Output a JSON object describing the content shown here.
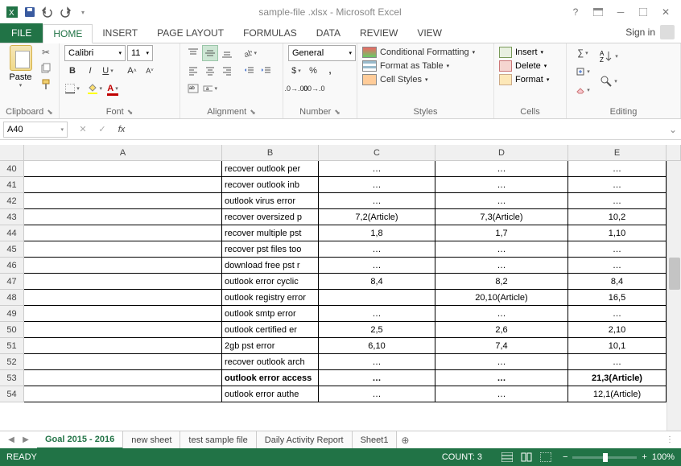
{
  "title": "sample-file .xlsx - Microsoft Excel",
  "signin": "Sign in",
  "tabs": {
    "file": "FILE",
    "list": [
      "HOME",
      "INSERT",
      "PAGE LAYOUT",
      "FORMULAS",
      "DATA",
      "REVIEW",
      "VIEW"
    ],
    "active": 0
  },
  "ribbon": {
    "clipboard": {
      "label": "Clipboard",
      "paste": "Paste"
    },
    "font": {
      "label": "Font",
      "name": "Calibri",
      "size": "11"
    },
    "alignment": {
      "label": "Alignment"
    },
    "number": {
      "label": "Number",
      "format": "General"
    },
    "styles": {
      "label": "Styles",
      "cond": "Conditional Formatting",
      "table": "Format as Table",
      "cell": "Cell Styles"
    },
    "cells": {
      "label": "Cells",
      "insert": "Insert",
      "delete": "Delete",
      "format": "Format"
    },
    "editing": {
      "label": "Editing"
    }
  },
  "namebox": "A40",
  "columns": [
    "A",
    "B",
    "C",
    "D",
    "E"
  ],
  "rows": [
    {
      "n": "40",
      "b": "recover outlook per",
      "c": "…",
      "d": "…",
      "e": "…"
    },
    {
      "n": "41",
      "b": "recover outlook inb",
      "c": "…",
      "d": "…",
      "e": "…"
    },
    {
      "n": "42",
      "b": "outlook virus error",
      "c": "…",
      "d": "…",
      "e": "…"
    },
    {
      "n": "43",
      "b": "recover oversized p",
      "c": "7,2(Article)",
      "d": "7,3(Article)",
      "e": "10,2"
    },
    {
      "n": "44",
      "b": "recover multiple pst",
      "c": "1,8",
      "d": "1,7",
      "e": "1,10"
    },
    {
      "n": "45",
      "b": "recover pst files too",
      "c": "…",
      "d": "…",
      "e": "…"
    },
    {
      "n": "46",
      "b": "download free pst r",
      "c": "…",
      "d": "…",
      "e": "…"
    },
    {
      "n": "47",
      "b": "outlook error cyclic",
      "c": "8,4",
      "d": "8,2",
      "e": "8,4"
    },
    {
      "n": "48",
      "b": "outlook registry error",
      "c": "",
      "d": "20,10(Article)",
      "e": "16,5"
    },
    {
      "n": "49",
      "b": "outlook smtp error",
      "c": "…",
      "d": "…",
      "e": "…"
    },
    {
      "n": "50",
      "b": "outlook certified er",
      "c": "2,5",
      "d": "2,6",
      "e": "2,10"
    },
    {
      "n": "51",
      "b": "2gb pst error",
      "c": "6,10",
      "d": "7,4",
      "e": "10,1"
    },
    {
      "n": "52",
      "b": "recover outlook arch",
      "c": "…",
      "d": "…",
      "e": "…"
    },
    {
      "n": "53",
      "b": "outlook error access",
      "c": "…",
      "d": "…",
      "e": "21,3(Article)",
      "bold": true
    },
    {
      "n": "54",
      "b": "outlook error authe",
      "c": "…",
      "d": "…",
      "e": "12,1(Article)"
    }
  ],
  "sheets": [
    "Goal 2015 - 2016",
    "new sheet",
    "test sample file",
    "Daily Activity Report",
    "Sheet1"
  ],
  "active_sheet": 0,
  "status": {
    "ready": "READY",
    "count": "COUNT: 3",
    "zoom": "100%"
  }
}
